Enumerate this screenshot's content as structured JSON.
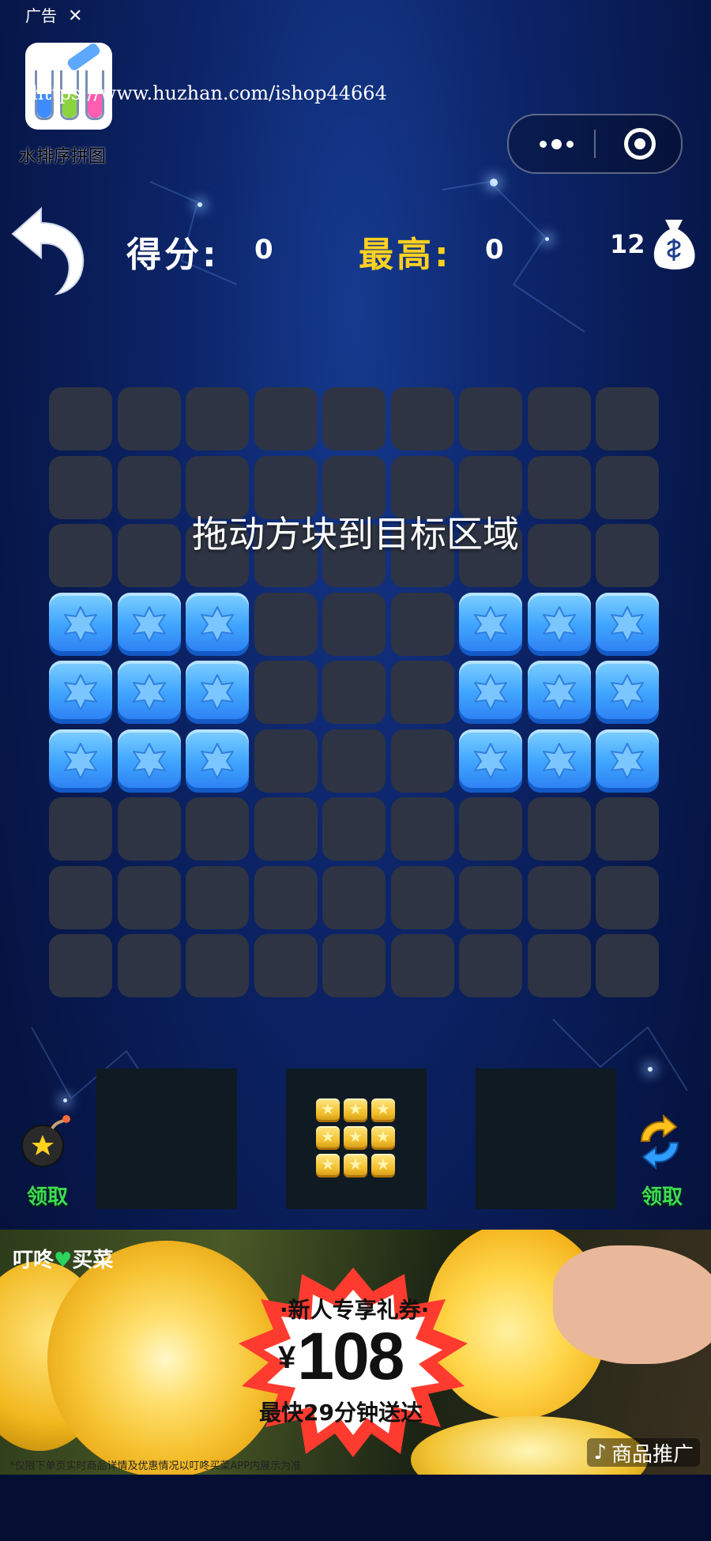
{
  "ad_tag": {
    "label": "广告",
    "close": "✕"
  },
  "mini_program": {
    "name": "水排序拼图",
    "watermark": "https://www.huzhan.com/ishop44664"
  },
  "capsule": {
    "more_icon": "more-dots-icon",
    "close_icon": "target-close-icon"
  },
  "header": {
    "score_label": "得分:",
    "score_value": "0",
    "best_label": "最高:",
    "best_value": "0",
    "coins_value": "12"
  },
  "board": {
    "rows": 9,
    "cols": 9,
    "hint": "拖动方块到目标区域",
    "filled": [
      [
        3,
        0
      ],
      [
        3,
        1
      ],
      [
        3,
        2
      ],
      [
        3,
        6
      ],
      [
        3,
        7
      ],
      [
        3,
        8
      ],
      [
        4,
        0
      ],
      [
        4,
        1
      ],
      [
        4,
        2
      ],
      [
        4,
        6
      ],
      [
        4,
        7
      ],
      [
        4,
        8
      ],
      [
        5,
        0
      ],
      [
        5,
        1
      ],
      [
        5,
        2
      ],
      [
        5,
        6
      ],
      [
        5,
        7
      ],
      [
        5,
        8
      ]
    ],
    "filled_color": "#41a6ff",
    "empty_color": "#2e3443"
  },
  "pieces": {
    "slots": [
      "empty",
      "3x3-yellow",
      "empty"
    ],
    "piece_color": "#f3c12f"
  },
  "powerups": {
    "left_label": "领取",
    "right_label": "领取"
  },
  "ad": {
    "brand_a": "叮咚",
    "brand_b": "买菜",
    "subtitle": "·新人专享礼券·",
    "currency": "¥",
    "price": "108",
    "delivery": "最快29分钟送达",
    "disclaimer": "*仅限下单页实时商品详情及优惠情况以叮咚买菜APP内展示为准",
    "product_label": "商品推广"
  }
}
